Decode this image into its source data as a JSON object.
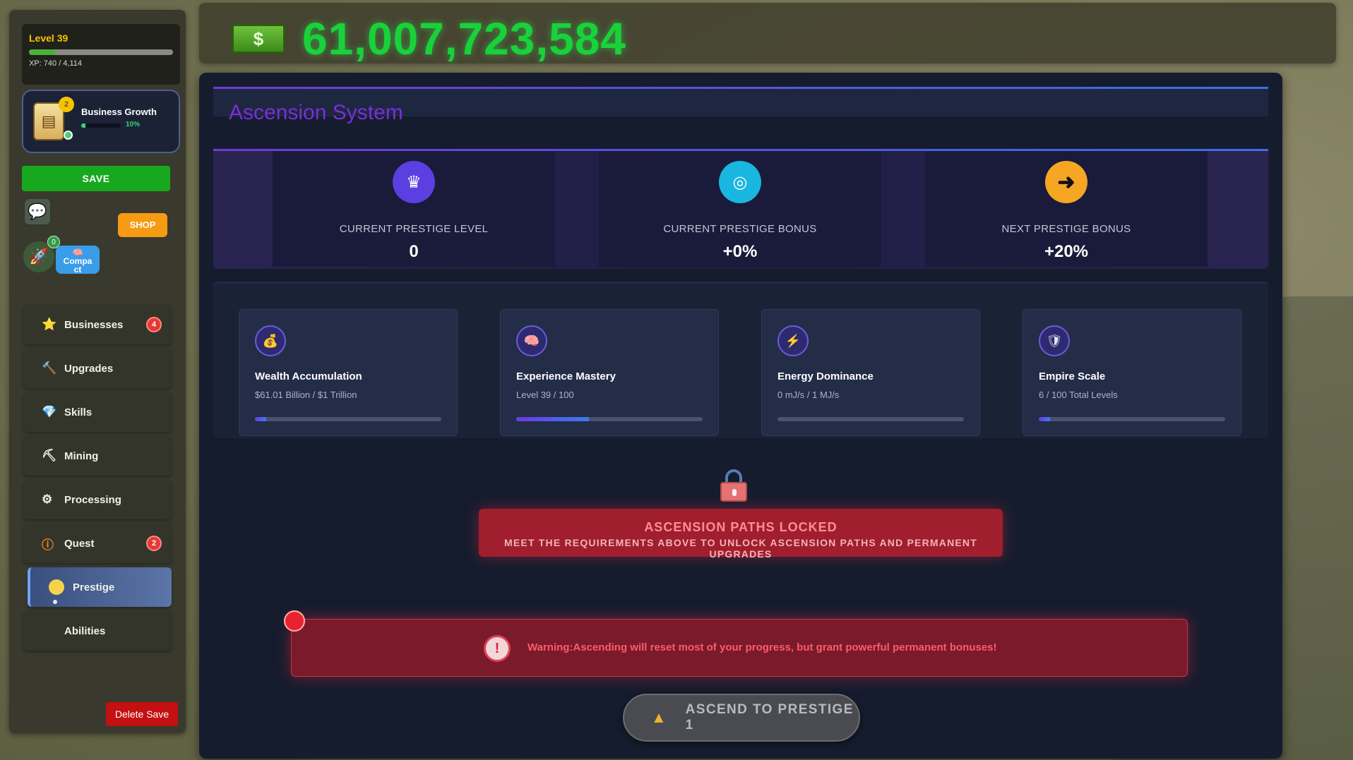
{
  "player": {
    "level_label": "Level 39",
    "xp_text": "XP: 740 / 4,114",
    "xp_fraction": 0.18
  },
  "business_growth": {
    "title": "Business Growth",
    "badge": "2",
    "percent": "10%",
    "fraction": 0.1
  },
  "sidebar": {
    "save_label": "SAVE",
    "shop_label": "SHOP",
    "rocket_badge": "0",
    "compact_label": "Compact",
    "delete_label": "Delete Save",
    "items": [
      {
        "label": "Businesses",
        "icon": "star-icon",
        "badge": "4"
      },
      {
        "label": "Upgrades",
        "icon": "hammer-icon",
        "badge": ""
      },
      {
        "label": "Skills",
        "icon": "gem-icon",
        "badge": ""
      },
      {
        "label": "Mining",
        "icon": "pickaxe-icon",
        "badge": ""
      },
      {
        "label": "Processing",
        "icon": "gear-icon",
        "badge": ""
      },
      {
        "label": "Quest",
        "icon": "info-icon",
        "badge": "2"
      },
      {
        "label": "Prestige",
        "icon": "coin-icon",
        "badge": ""
      },
      {
        "label": "Abilities",
        "icon": "",
        "badge": ""
      }
    ]
  },
  "money": {
    "value": "61,007,723,584",
    "icon": "cash-icon"
  },
  "ascension": {
    "title": "Ascension System",
    "stats": [
      {
        "label": "CURRENT PRESTIGE LEVEL",
        "value": "0",
        "icon": "crown-icon",
        "color": "#5b3fe0"
      },
      {
        "label": "CURRENT PRESTIGE BONUS",
        "value": "+0%",
        "icon": "chip-icon",
        "color": "#19b6e0"
      },
      {
        "label": "NEXT PRESTIGE BONUS",
        "value": "+20%",
        "icon": "arrow-right-icon",
        "color": "#f5a623"
      }
    ],
    "requirements": [
      {
        "title": "Wealth Accumulation",
        "sub": "$61.01 Billion / $1 Trillion",
        "fraction": 0.061,
        "icon": "money-bag-icon"
      },
      {
        "title": "Experience Mastery",
        "sub": "Level 39 / 100",
        "fraction": 0.39,
        "icon": "brain-icon"
      },
      {
        "title": "Energy Dominance",
        "sub": "0 mJ/s / 1 MJ/s",
        "fraction": 0.0,
        "icon": "lightning-icon"
      },
      {
        "title": "Empire Scale",
        "sub": "6 / 100 Total Levels",
        "fraction": 0.06,
        "icon": "shield-icon"
      }
    ],
    "locked_title": "ASCENSION PATHS LOCKED",
    "locked_sub": "MEET THE REQUIREMENTS ABOVE TO UNLOCK ASCENSION PATHS AND PERMANENT UPGRADES",
    "warning_text": "Warning:Ascending will reset most of your progress, but grant powerful permanent bonuses!",
    "ascend_label": "ASCEND TO PRESTIGE 1"
  }
}
